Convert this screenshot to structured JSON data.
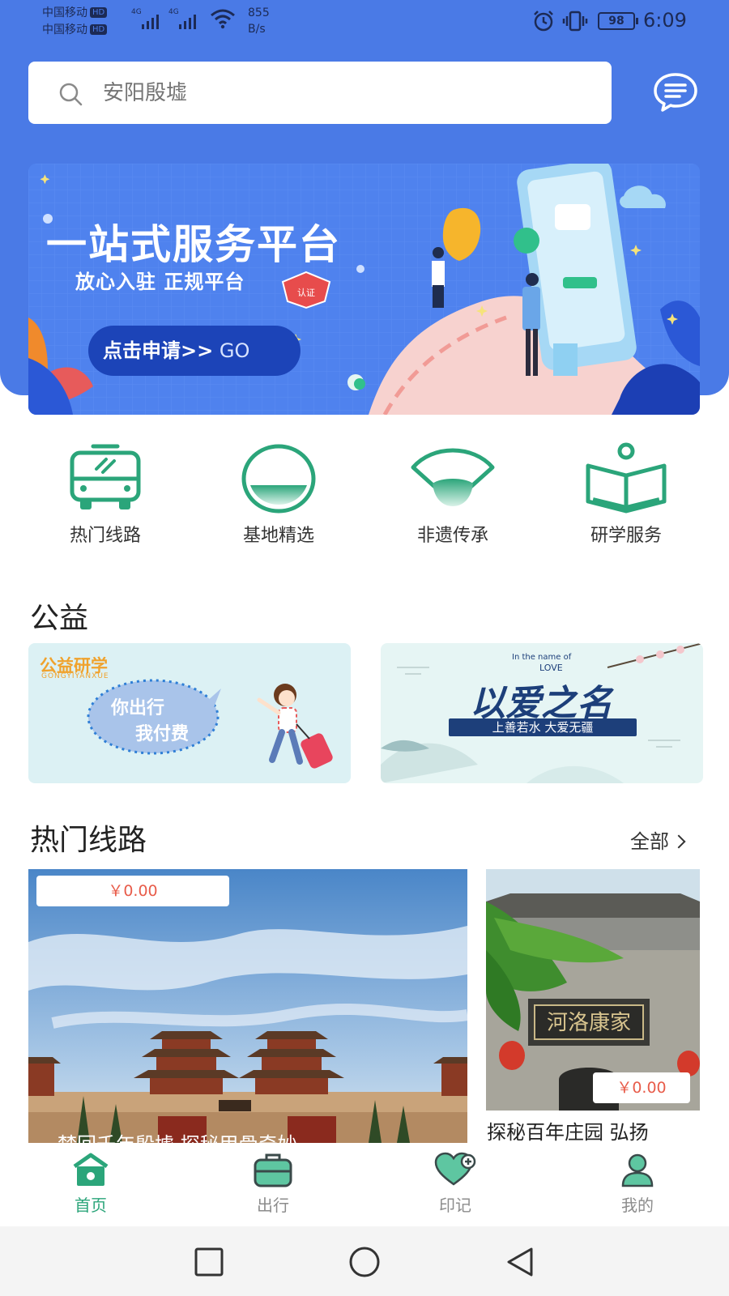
{
  "status_bar": {
    "carrier1": "中国移动",
    "carrier2": "中国移动",
    "hd": "HD",
    "net1": "4G",
    "net2": "4G",
    "speed_value": "855",
    "speed_unit": "B/s",
    "battery": "98",
    "time": "6:09"
  },
  "search": {
    "placeholder": "安阳殷墟"
  },
  "banner": {
    "title": "一站式服务平台",
    "subtitle": "放心入驻 正规平台",
    "badge": "认证",
    "button_label": "点击申请>>",
    "button_go": " GO"
  },
  "quick_entries": [
    {
      "label": "热门线路",
      "icon": "bus-icon"
    },
    {
      "label": "基地精选",
      "icon": "base-icon"
    },
    {
      "label": "非遗传承",
      "icon": "fan-icon"
    },
    {
      "label": "研学服务",
      "icon": "book-icon"
    }
  ],
  "public_welfare": {
    "title": "公益",
    "card1": {
      "title": "公益研学",
      "pinyin": "GONGYIYANXUE",
      "line1": "你出行",
      "line2": "我付费"
    },
    "card2": {
      "love": "LOVE",
      "in_name": "In the name of",
      "script": "以爱之名",
      "ribbon": "上善若水 大爱无疆"
    }
  },
  "hot_routes": {
    "title": "热门线路",
    "more_label": "全部",
    "items": [
      {
        "price": "￥0.00",
        "title": "梦回千年殷墟 探秘甲骨奇妙"
      },
      {
        "price": "￥0.00",
        "title": "探秘百年庄园 弘扬",
        "sign": "河洛康家"
      }
    ]
  },
  "tab_bar": {
    "tabs": [
      {
        "label": "首页",
        "icon": "home-icon",
        "active": true
      },
      {
        "label": "出行",
        "icon": "suitcase-icon",
        "active": false
      },
      {
        "label": "印记",
        "icon": "heart-icon",
        "active": false
      },
      {
        "label": "我的",
        "icon": "user-icon",
        "active": false
      }
    ]
  },
  "colors": {
    "brand_blue": "#4a7ae6",
    "accent_green": "#2ba57a",
    "price_red": "#e85c4a"
  }
}
